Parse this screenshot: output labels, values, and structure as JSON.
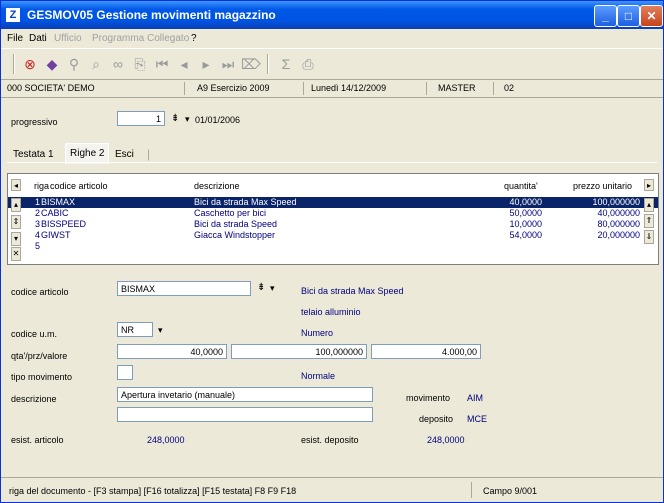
{
  "window": {
    "icon_letter": "Z",
    "title": "GESMOV05  Gestione movimenti magazzino"
  },
  "menu": [
    "File",
    "Dati",
    "Ufficio",
    "Programma Collegato",
    "?"
  ],
  "info": {
    "company": "000 SOCIETA'  DEMO",
    "exercise": "A9 Esercizio 2009",
    "date": "Lunedì  14/12/2009",
    "user": "MASTER",
    "code": "02"
  },
  "header": {
    "progressivo_label": "progressivo",
    "progressivo_value": "1",
    "progressivo_date": "01/01/2006"
  },
  "tabs": [
    "Testata 1",
    "Righe 2",
    "Esci"
  ],
  "grid": {
    "columns": [
      "riga",
      "codice articolo",
      "descrizione",
      "quantita'",
      "prezzo unitario"
    ],
    "rows": [
      {
        "riga": "1",
        "codice": "BISMAX",
        "descrizione": "Bici da strada Max Speed",
        "quantita": "40,0000",
        "prezzo": "100,000000"
      },
      {
        "riga": "2",
        "codice": "CABIC",
        "descrizione": "Caschetto per bici",
        "quantita": "50,0000",
        "prezzo": "40,000000"
      },
      {
        "riga": "3",
        "codice": "BISSPEED",
        "descrizione": "Bici da strada Speed",
        "quantita": "10,0000",
        "prezzo": "80,000000"
      },
      {
        "riga": "4",
        "codice": "GIWST",
        "descrizione": "Giacca Windstopper",
        "quantita": "54,0000",
        "prezzo": "20,000000"
      },
      {
        "riga": "5",
        "codice": "",
        "descrizione": "",
        "quantita": "",
        "prezzo": ""
      }
    ]
  },
  "form": {
    "codice_articolo_label": "codice articolo",
    "codice_articolo_value": "BISMAX",
    "articolo_desc1": "Bici da strada Max Speed",
    "articolo_desc2": "telaio alluminio",
    "codice_um_label": "codice u.m.",
    "codice_um_value": "NR",
    "um_desc": "Numero",
    "qta_label": "qta'/prz/valore",
    "qta_value": "40,0000",
    "prz_value": "100,000000",
    "valore_value": "4.000,00",
    "tipo_movimento_label": "tipo movimento",
    "tipo_movimento_value": "",
    "tipo_movimento_desc": "Normale",
    "descrizione_label": "descrizione",
    "descrizione_value": "Apertura invetario (manuale)",
    "descrizione_value2": "",
    "movimento_label": "movimento",
    "movimento_value": "AIM",
    "deposito_label": "deposito",
    "deposito_value": "MCE",
    "esist_articolo_label": "esist. articolo",
    "esist_articolo_value": "248,0000",
    "esist_deposito_label": "esist. deposito",
    "esist_deposito_value": "248,0000"
  },
  "status": {
    "left": "riga del documento - [F3 stampa] [F16 totalizza] [F15 testata] F8  F9  F18",
    "right": "Campo  9/001"
  }
}
